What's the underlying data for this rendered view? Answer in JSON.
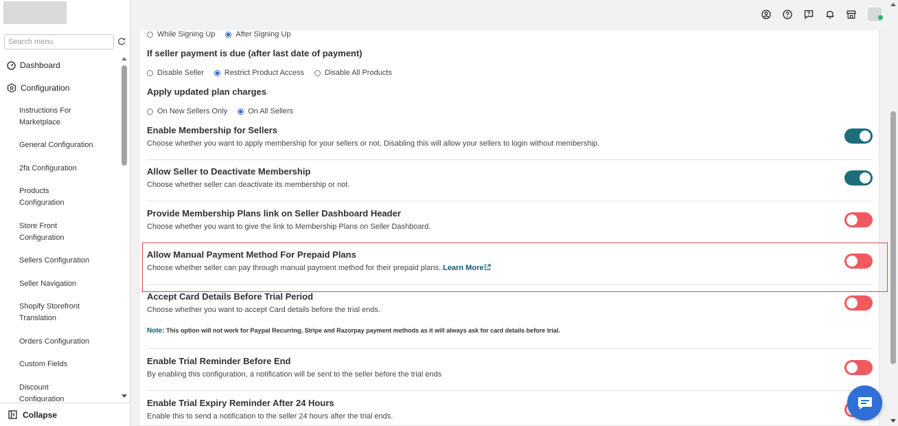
{
  "sidebar": {
    "search_placeholder": "Search menu",
    "items": [
      {
        "label": "Dashboard",
        "icon": "dashboard-gauge-icon"
      },
      {
        "label": "Configuration",
        "icon": "configuration-hexagon-icon"
      }
    ],
    "sub_items": [
      "Instructions For Marketplace",
      "General Configuration",
      "2fa Configuration",
      "Products Configuration",
      "Store Front Configuration",
      "Sellers Configuration",
      "Seller Navigation",
      "Shopify Storefront Translation",
      "Orders Configuration",
      "Custom Fields",
      "Discount Configuration"
    ],
    "collapse_label": "Collapse"
  },
  "topbar": {
    "icons": [
      "user-circle-icon",
      "help-circle-icon",
      "feedback-icon",
      "bell-icon",
      "store-icon"
    ]
  },
  "main": {
    "signup_options": [
      "While Signing Up",
      "After Signing Up"
    ],
    "signup_selected": 1,
    "payment_due_question": "If seller payment is due (after last date of payment)",
    "payment_due_options": [
      "Disable Seller",
      "Restrict Product Access",
      "Disable All Products"
    ],
    "payment_due_selected": 1,
    "plan_charges_question": "Apply updated plan charges",
    "plan_charges_options": [
      "On New Sellers Only",
      "On All Sellers"
    ],
    "plan_charges_selected": 1,
    "settings": [
      {
        "title": "Enable Membership for Sellers",
        "desc": "Choose whether you want to apply membership for your sellers or not. Disabling this will allow your sellers to login without membership.",
        "enabled": true
      },
      {
        "title": "Allow Seller to Deactivate Membership",
        "desc": "Choose whether seller can deactivate its membership or not.",
        "enabled": true
      },
      {
        "title": "Provide Membership Plans link on Seller Dashboard Header",
        "desc": "Choose whether you want to give the link to Membership Plans on Seller Dashboard.",
        "enabled": false
      },
      {
        "title": "Allow Manual Payment Method For Prepaid Plans",
        "desc": "Choose whether seller can pay through manual payment method for their prepaid plans..",
        "link": "Learn More",
        "enabled": false
      },
      {
        "title": "Accept Card Details Before Trial Period",
        "desc": "Choose whether you want to accept Card details before the trial ends.",
        "enabled": false
      },
      {
        "title": "Enable Trial Reminder Before End",
        "desc": "By enabling this configuration, a notification will be sent to the seller before the trial ends",
        "enabled": false
      },
      {
        "title": "Enable Trial Expiry Reminder After 24 Hours",
        "desc": "Enable this to send a notification to the seller 24 hours after the trial ends.",
        "enabled": false
      }
    ],
    "note_label": "Note:",
    "note_text": " This option will not work for Paypal Recurring, Stripe and Razorpay payment methods as it will always ask for card details before trial."
  },
  "colors": {
    "toggle_on": "#1c6e7a",
    "toggle_off": "#f05a5f",
    "highlight": "#e84545",
    "chat_button": "#2f6fd6"
  }
}
